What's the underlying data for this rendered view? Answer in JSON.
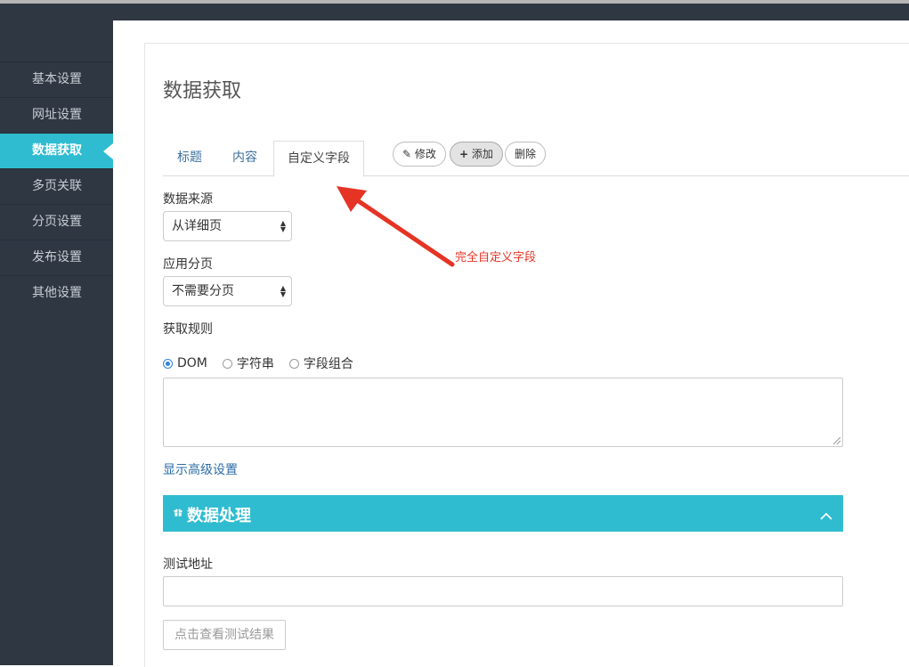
{
  "sidebar": {
    "items": [
      {
        "label": "基本设置"
      },
      {
        "label": "网址设置"
      },
      {
        "label": "数据获取",
        "active": true
      },
      {
        "label": "多页关联"
      },
      {
        "label": "分页设置"
      },
      {
        "label": "发布设置"
      },
      {
        "label": "其他设置"
      }
    ]
  },
  "page": {
    "title": "数据获取"
  },
  "tabs": [
    {
      "label": "标题"
    },
    {
      "label": "内容"
    },
    {
      "label": "自定义字段",
      "active": true
    }
  ],
  "toolbar": {
    "edit_label": "修改",
    "add_label": "添加",
    "delete_label": "删除"
  },
  "form": {
    "source_label": "数据来源",
    "source_value": "从详细页",
    "paging_label": "应用分页",
    "paging_value": "不需要分页",
    "rule_label": "获取规则",
    "rule_options": [
      {
        "label": "DOM",
        "checked": true
      },
      {
        "label": "字符串",
        "checked": false
      },
      {
        "label": "字段组合",
        "checked": false
      }
    ],
    "advanced_link": "显示高级设置"
  },
  "section": {
    "title": "数据处理"
  },
  "test": {
    "label": "测试地址",
    "button_label": "点击查看测试结果"
  },
  "annotation": {
    "text": "完全自定义字段"
  },
  "colors": {
    "sidebar_bg": "#2e3742",
    "accent": "#2fbcd0",
    "link": "#2c6da8",
    "annotation": "#e53424"
  }
}
